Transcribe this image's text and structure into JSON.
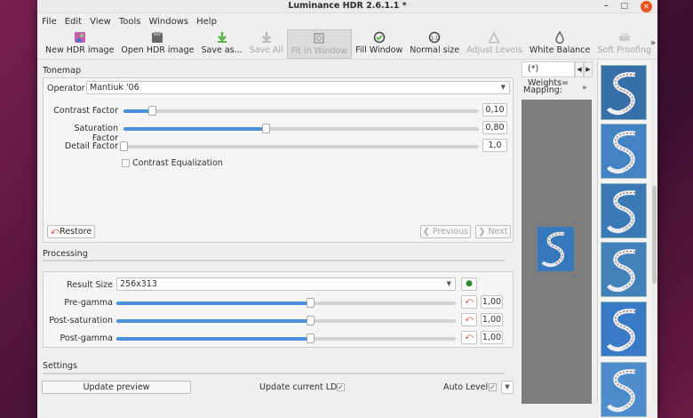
{
  "window": {
    "title": "Luminance HDR 2.6.1.1 *",
    "controls": {
      "minimize": "–",
      "maximize": "□",
      "close": "✕"
    }
  },
  "menu": [
    "File",
    "Edit",
    "View",
    "Tools",
    "Windows",
    "Help"
  ],
  "toolbar": {
    "items": [
      {
        "label": "New HDR image",
        "icon": "new-hdr-icon",
        "state": "enabled"
      },
      {
        "label": "Open HDR image",
        "icon": "open-hdr-icon",
        "state": "enabled"
      },
      {
        "label": "Save as...",
        "icon": "save-as-icon",
        "state": "enabled"
      },
      {
        "label": "Save All",
        "icon": "save-all-icon",
        "state": "disabled"
      },
      {
        "label": "Fit in Window",
        "icon": "fit-window-icon",
        "state": "active"
      },
      {
        "label": "Fill Window",
        "icon": "fill-window-icon",
        "state": "enabled"
      },
      {
        "label": "Normal size",
        "icon": "normal-size-icon",
        "state": "enabled"
      },
      {
        "label": "Adjust Levels",
        "icon": "adjust-levels-icon",
        "state": "disabled"
      },
      {
        "label": "White Balance",
        "icon": "white-balance-icon",
        "state": "enabled"
      },
      {
        "label": "Soft Proofing",
        "icon": "soft-proofing-icon",
        "state": "disabled"
      }
    ],
    "overflow": "»"
  },
  "tonemap": {
    "title": "Tonemap",
    "operator_label": "Operator",
    "operator_value": "Mantiuk '06",
    "params": [
      {
        "label": "Contrast Factor",
        "value": "0,10",
        "level": 0.08
      },
      {
        "label": "Saturation Factor",
        "value": "0,80",
        "level": 0.4
      },
      {
        "label": "Detail Factor",
        "value": "1,0",
        "level": 0.0
      }
    ],
    "contrast_eq_label": "Contrast Equalization",
    "restore_label": "Restore",
    "previous_label": "Previous",
    "next_label": "Next"
  },
  "processing": {
    "title": "Processing",
    "result_size_label": "Result Size",
    "result_size_value": "256x313",
    "params": [
      {
        "label": "Pre-gamma",
        "value": "1,00",
        "level": 0.57
      },
      {
        "label": "Post-saturation",
        "value": "1,00",
        "level": 0.57
      },
      {
        "label": "Post-gamma",
        "value": "1,00",
        "level": 0.57
      }
    ]
  },
  "settings": {
    "title": "Settings",
    "update_preview_label": "Update preview",
    "update_ldr_label": "Update current LDR",
    "auto_levels_label": "Auto Levels"
  },
  "mid": {
    "tab_label": "(*) Weights=",
    "mapping_label": "Mapping:",
    "overflow": "»"
  },
  "colors": {
    "accent": "#4a90d9",
    "close": "#e95420",
    "reset": "#e02020"
  }
}
